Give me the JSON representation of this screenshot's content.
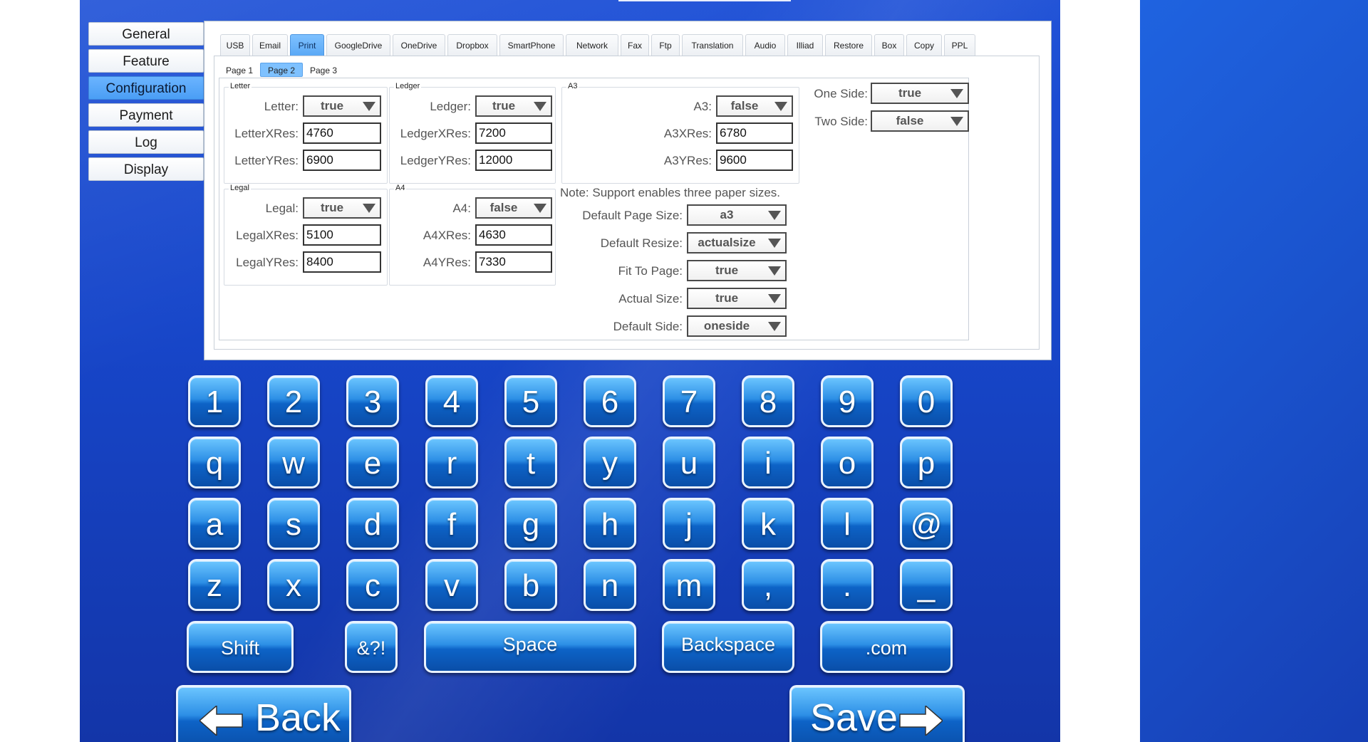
{
  "sidebar": {
    "items": [
      "General",
      "Feature",
      "Configuration",
      "Payment",
      "Log",
      "Display"
    ],
    "active": "Configuration"
  },
  "tabs": [
    "USB",
    "Email",
    "Print",
    "GoogleDrive",
    "OneDrive",
    "Dropbox",
    "SmartPhone",
    "Network",
    "Fax",
    "Ftp",
    "Translation",
    "Audio",
    "Illiad",
    "Restore",
    "Box",
    "Copy",
    "PPL"
  ],
  "active_tab": "Print",
  "subtabs": [
    "Page 1",
    "Page 2",
    "Page 3"
  ],
  "active_subtab": "Page 2",
  "letter": {
    "title": "Letter",
    "enabled_label": "Letter:",
    "enabled": "true",
    "xres_label": "LetterXRes:",
    "xres": "4760",
    "yres_label": "LetterYRes:",
    "yres": "6900"
  },
  "ledger": {
    "title": "Ledger",
    "enabled_label": "Ledger:",
    "enabled": "true",
    "xres_label": "LedgerXRes:",
    "xres": "7200",
    "yres_label": "LedgerYRes:",
    "yres": "12000"
  },
  "a3": {
    "title": "A3",
    "enabled_label": "A3:",
    "enabled": "false",
    "xres_label": "A3XRes:",
    "xres": "6780",
    "yres_label": "A3YRes:",
    "yres": "9600"
  },
  "legal": {
    "title": "Legal",
    "enabled_label": "Legal:",
    "enabled": "true",
    "xres_label": "LegalXRes:",
    "xres": "5100",
    "yres_label": "LegalYRes:",
    "yres": "8400"
  },
  "a4": {
    "title": "A4",
    "enabled_label": "A4:",
    "enabled": "false",
    "xres_label": "A4XRes:",
    "xres": "4630",
    "yres_label": "A4YRes:",
    "yres": "7330"
  },
  "sides": {
    "one_label": "One Side:",
    "one": "true",
    "two_label": "Two Side:",
    "two": "false"
  },
  "note": "Note: Support enables three paper sizes.",
  "defaults": {
    "page_size_label": "Default Page Size:",
    "page_size": "a3",
    "resize_label": "Default Resize:",
    "resize": "actualsize",
    "fit_label": "Fit To Page:",
    "fit": "true",
    "actual_label": "Actual Size:",
    "actual": "true",
    "side_label": "Default Side:",
    "side": "oneside"
  },
  "keyboard": {
    "rows": [
      [
        "1",
        "2",
        "3",
        "4",
        "5",
        "6",
        "7",
        "8",
        "9",
        "0"
      ],
      [
        "q",
        "w",
        "e",
        "r",
        "t",
        "y",
        "u",
        "i",
        "o",
        "p"
      ],
      [
        "a",
        "s",
        "d",
        "f",
        "g",
        "h",
        "j",
        "k",
        "l",
        "@"
      ],
      [
        "z",
        "x",
        "c",
        "v",
        "b",
        "n",
        "m",
        ",",
        ".",
        "_"
      ]
    ],
    "shift": "Shift",
    "symbols": "&?!",
    "space": "Space",
    "backspace": "Backspace",
    "dotcom": ".com"
  },
  "nav": {
    "back": "Back",
    "save": "Save"
  },
  "colors": {
    "background": "#1746c9",
    "key": "#1e7fe0",
    "active": "#5aa8f5"
  }
}
